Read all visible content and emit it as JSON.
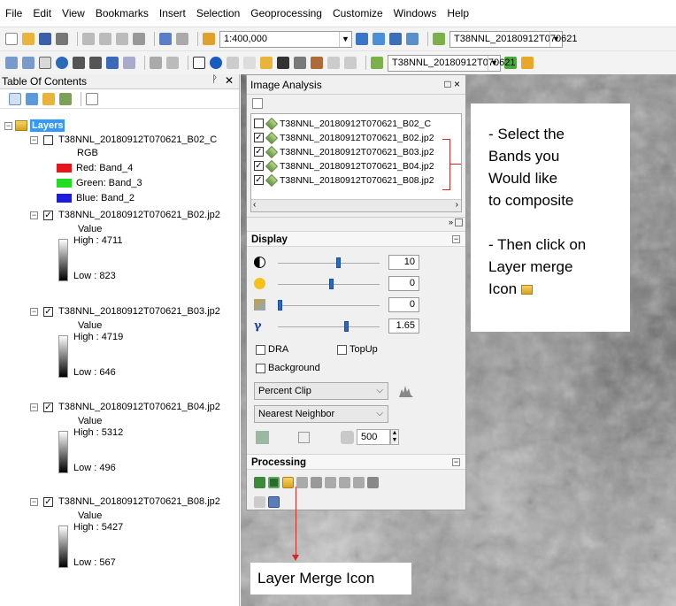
{
  "menubar": {
    "items": [
      "File",
      "Edit",
      "View",
      "Bookmarks",
      "Insert",
      "Selection",
      "Geoprocessing",
      "Customize",
      "Windows",
      "Help"
    ]
  },
  "toolbar": {
    "scale": "1:400,000",
    "layer_combo_1": "T38NNL_20180912T070621",
    "layer_combo_2": "T38NNL_20180912T070621"
  },
  "toc": {
    "title": "Table Of Contents",
    "pin": "P",
    "close": "×",
    "group_name": "Layers",
    "composite_layer": {
      "name": "T38NNL_20180912T070621_B02_C",
      "rgb_label": "RGB",
      "red": "Red:  Band_4",
      "green": "Green: Band_3",
      "blue": "Blue:  Band_2"
    },
    "layers": [
      {
        "name": "T38NNL_20180912T070621_B02.jp2",
        "value_label": "Value",
        "high": "High : 4711",
        "low": "Low : 823"
      },
      {
        "name": "T38NNL_20180912T070621_B03.jp2",
        "value_label": "Value",
        "high": "High : 4719",
        "low": "Low : 646"
      },
      {
        "name": "T38NNL_20180912T070621_B04.jp2",
        "value_label": "Value",
        "high": "High : 5312",
        "low": "Low : 496"
      },
      {
        "name": "T38NNL_20180912T070621_B08.jp2",
        "value_label": "Value",
        "high": "High : 5427",
        "low": "Low : 567"
      }
    ]
  },
  "image_analysis": {
    "title": "Image Analysis",
    "controls": "□ ×",
    "layer_list": [
      {
        "name": "T38NNL_20180912T070621_B02_C",
        "checked": false
      },
      {
        "name": "T38NNL_20180912T070621_B02.jp2",
        "checked": true
      },
      {
        "name": "T38NNL_20180912T070621_B03.jp2",
        "checked": true
      },
      {
        "name": "T38NNL_20180912T070621_B04.jp2",
        "checked": true
      },
      {
        "name": "T38NNL_20180912T070621_B08.jp2",
        "checked": true
      }
    ],
    "display": {
      "header": "Display",
      "contrast": "10",
      "brightness": "0",
      "transparency": "0",
      "gamma": "1.65",
      "contrast_level": 0.6,
      "brightness_level": 0.53,
      "transparency_level": 0.0,
      "gamma_level": 0.68,
      "dra_label": "DRA",
      "topup_label": "TopUp",
      "background_label": "Background",
      "stretch": "Percent Clip",
      "resampling": "Nearest Neighbor",
      "dpi": "500"
    },
    "processing": {
      "header": "Processing"
    }
  },
  "annotations": {
    "callout1": [
      "- Select the",
      "Bands you",
      "Would like",
      "to composite",
      "",
      "- Then click on",
      "Layer merge",
      "Icon"
    ],
    "callout2": "Layer Merge Icon"
  },
  "colors": {
    "red_band": "#e8141a",
    "green_band": "#22dd22",
    "blue_band": "#1a1ae0",
    "annotation_red": "#d12a2a",
    "toc_selected": "#3399ff"
  }
}
